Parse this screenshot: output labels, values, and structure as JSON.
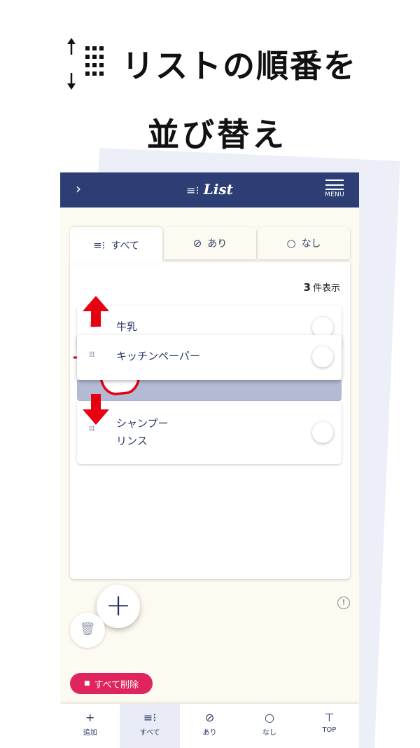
{
  "headline": {
    "line1": "リストの順番を",
    "line2": "並び替え",
    "icon": "reorder-drag-icon"
  },
  "appbar": {
    "back_glyph": "›",
    "title": "List",
    "title_icon": "≡⁝",
    "menu_label": "MENU"
  },
  "tabs": [
    {
      "glyph": "≡⁝",
      "label": "すべて"
    },
    {
      "glyph": "⊘",
      "label": "あり"
    },
    {
      "glyph": "○",
      "label": "なし"
    }
  ],
  "list": {
    "count": "3",
    "count_suffix": "件表示",
    "items": [
      {
        "label": "牛乳"
      },
      {
        "label": "キッチンペーパー"
      },
      {
        "label_line1": "シャンプー",
        "label_line2": "リンス"
      }
    ]
  },
  "fab": {
    "glyph": "+"
  },
  "info": {
    "glyph": "!"
  },
  "trash": {
    "glyph": "🗑"
  },
  "delete_all": {
    "glyph": "■",
    "label": "すべて削除"
  },
  "bottom_nav": [
    {
      "glyph": "+",
      "label": "追加"
    },
    {
      "glyph": "≡⁝",
      "label": "すべて"
    },
    {
      "glyph": "⊘",
      "label": "あり"
    },
    {
      "glyph": "○",
      "label": "なし"
    },
    {
      "glyph": "⊤",
      "label": "TOP"
    }
  ],
  "colors": {
    "navy": "#2d3e74",
    "accent_red": "#e60012",
    "delete_pink": "#e0245e",
    "background": "#fdfbf1"
  }
}
